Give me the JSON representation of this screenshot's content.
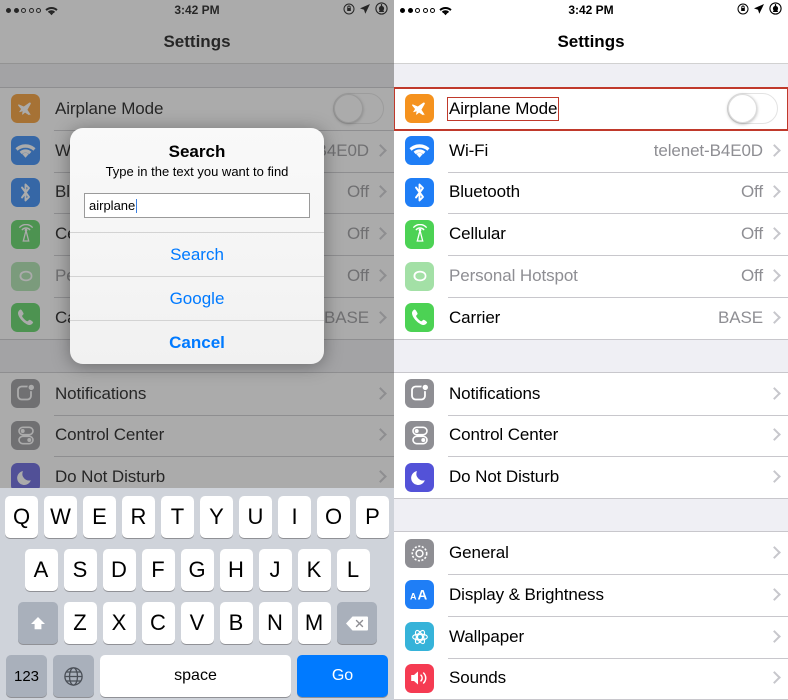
{
  "status_bar": {
    "signal_dots_filled": 2,
    "signal_dots_total": 5,
    "wifi_icon": "wifi-icon",
    "time": "3:42 PM",
    "rotation_lock_icon": "rotation-lock-icon",
    "location_icon": "location-arrow-icon",
    "battery_icon": "battery-icon"
  },
  "nav": {
    "title": "Settings"
  },
  "settings": {
    "group1": [
      {
        "label": "Airplane Mode",
        "icon": "airplane-icon",
        "color": "#f5921e",
        "control": "toggle",
        "toggle_on": false,
        "dim": false
      },
      {
        "label": "Wi-Fi",
        "icon": "wifi-icon",
        "color": "#1f7ef6",
        "value": "telenet-B4E0D",
        "control": "chevron",
        "dim": false
      },
      {
        "label": "Bluetooth",
        "icon": "bluetooth-icon",
        "color": "#1f7ef6",
        "value": "Off",
        "control": "chevron",
        "dim": false
      },
      {
        "label": "Cellular",
        "icon": "cellular-icon",
        "color": "#4cd254",
        "value": "Off",
        "control": "chevron",
        "dim": false
      },
      {
        "label": "Personal Hotspot",
        "icon": "hotspot-icon",
        "color": "#a3e0a6",
        "value": "Off",
        "control": "chevron",
        "dim": true
      },
      {
        "label": "Carrier",
        "icon": "phone-icon",
        "color": "#4cd254",
        "value": "BASE",
        "control": "chevron",
        "dim": false
      }
    ],
    "group2": [
      {
        "label": "Notifications",
        "icon": "notifications-icon",
        "color": "#8e8e93",
        "control": "chevron",
        "dim": false
      },
      {
        "label": "Control Center",
        "icon": "control-center-icon",
        "color": "#8e8e93",
        "control": "chevron",
        "dim": false
      },
      {
        "label": "Do Not Disturb",
        "icon": "moon-icon",
        "color": "#5352d8",
        "control": "chevron",
        "dim": false
      }
    ],
    "group3": [
      {
        "label": "General",
        "icon": "gear-icon",
        "color": "#8e8e93",
        "control": "chevron",
        "dim": false
      },
      {
        "label": "Display & Brightness",
        "icon": "display-brightness-icon",
        "color": "#1f7ef6",
        "control": "chevron",
        "dim": false
      },
      {
        "label": "Wallpaper",
        "icon": "wallpaper-icon",
        "color": "#36b3d9",
        "control": "chevron",
        "dim": false
      },
      {
        "label": "Sounds",
        "icon": "sounds-icon",
        "color": "#f53b52",
        "control": "chevron",
        "dim": false
      }
    ]
  },
  "dialog": {
    "title": "Search",
    "subtitle": "Type in the text you want to find",
    "input_value": "airplane",
    "input_placeholder": "",
    "buttons": [
      {
        "label": "Search",
        "style": "normal"
      },
      {
        "label": "Google",
        "style": "normal"
      },
      {
        "label": "Cancel",
        "style": "bold"
      }
    ]
  },
  "keyboard": {
    "row1": [
      "Q",
      "W",
      "E",
      "R",
      "T",
      "Y",
      "U",
      "I",
      "O",
      "P"
    ],
    "row2": [
      "A",
      "S",
      "D",
      "F",
      "G",
      "H",
      "J",
      "K",
      "L"
    ],
    "row3": [
      "Z",
      "X",
      "C",
      "V",
      "B",
      "N",
      "M"
    ],
    "shift_key": "shift-icon",
    "backspace_key": "backspace-icon",
    "numbers_key": "123",
    "globe_key": "globe-icon",
    "space_key": "space",
    "go_key": "Go"
  },
  "annotations": {
    "highlight_color": "#c0392b",
    "highlighted_row": "Airplane Mode",
    "highlighted_label": "Airplane Mode"
  }
}
